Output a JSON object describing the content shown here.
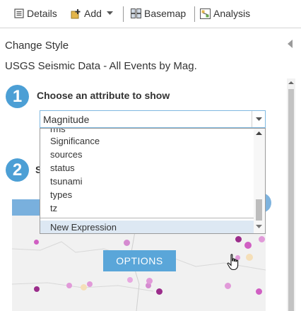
{
  "toolbar": {
    "details_label": "Details",
    "add_label": "Add",
    "basemap_label": "Basemap",
    "analysis_label": "Analysis"
  },
  "panel": {
    "title": "Change Style",
    "layer_name": "USGS Seismic Data - All Events by Mag.",
    "step1": {
      "number": "1",
      "label": "Choose an attribute to show"
    },
    "step2": {
      "number": "2",
      "label": "S"
    }
  },
  "attribute_select": {
    "selected": "Magnitude",
    "options_visible": [
      "rms",
      "Significance",
      "sources",
      "status",
      "tsunami",
      "types",
      "tz"
    ],
    "new_expression_label": "New Expression"
  },
  "map_preview": {
    "options_button_label": "OPTIONS"
  },
  "colors": {
    "accent_blue": "#4c9fd5",
    "options_button": "#5aa6d9",
    "dot_purple": "#9b2d8b",
    "dot_pink": "#d05fc3",
    "dot_cream": "#f5dfb8"
  }
}
